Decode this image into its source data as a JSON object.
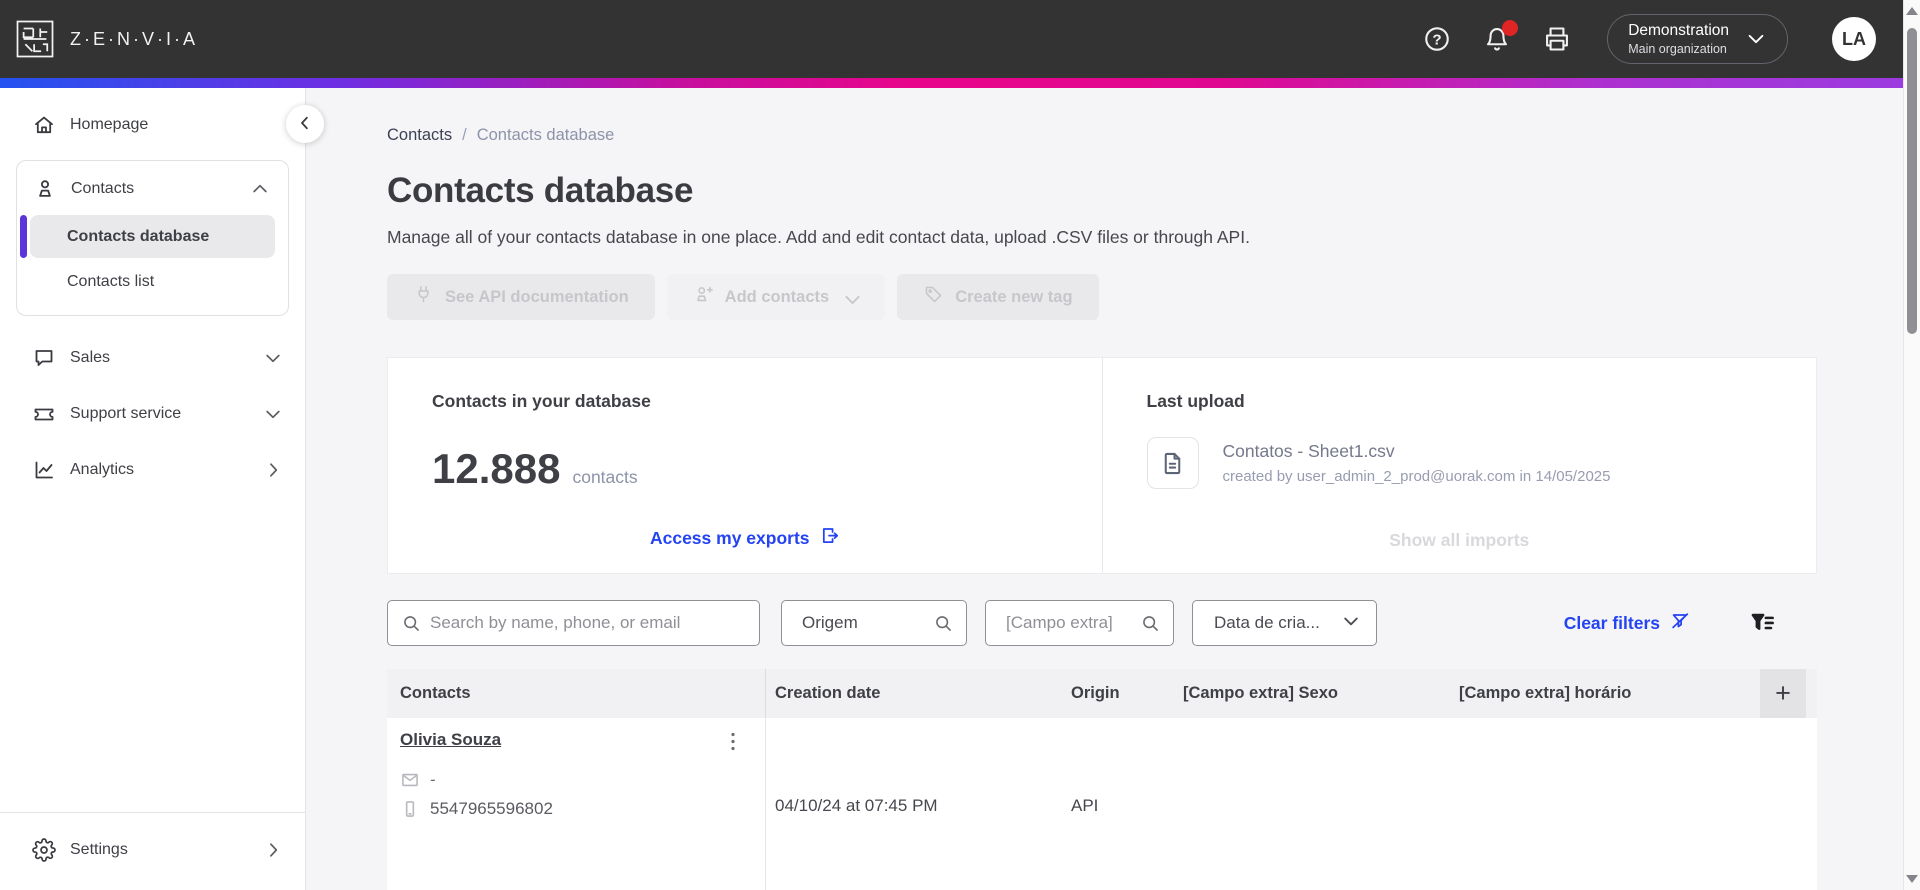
{
  "topbar": {
    "brand": "Z·E·N·V·I·A",
    "org_name": "Demonstration",
    "org_sub": "Main organization",
    "avatar_initials": "LA"
  },
  "sidebar": {
    "homepage": "Homepage",
    "contacts": "Contacts",
    "contacts_database": "Contacts database",
    "contacts_list": "Contacts list",
    "sales": "Sales",
    "support": "Support service",
    "analytics": "Analytics",
    "settings": "Settings"
  },
  "breadcrumb": {
    "parent": "Contacts",
    "separator": "/",
    "current": "Contacts database"
  },
  "page": {
    "title": "Contacts database",
    "description": "Manage all of your contacts database in one place. Add and edit contact data, upload .CSV files or through API."
  },
  "actions": {
    "see_api": "See API documentation",
    "add_contacts": "Add contacts",
    "create_tag": "Create new tag"
  },
  "stats_card": {
    "title": "Contacts in your database",
    "count": "12.888",
    "unit": "contacts",
    "link": "Access my exports"
  },
  "upload_card": {
    "title": "Last upload",
    "filename": "Contatos - Sheet1.csv",
    "meta": "created by user_admin_2_prod@uorak.com in 14/05/2025",
    "link": "Show all imports"
  },
  "filters": {
    "search_placeholder": "Search by name, phone, or email",
    "origem": "Origem",
    "campo_extra": "[Campo extra]",
    "creation_date": "Data de cria...",
    "clear": "Clear filters"
  },
  "table": {
    "columns": {
      "contacts": "Contacts",
      "creation_date": "Creation date",
      "origin": "Origin",
      "sexo": "[Campo extra] Sexo",
      "horario": "[Campo extra] horário"
    },
    "add_column": "+",
    "rows": [
      {
        "name": "Olivia Souza",
        "email": "-",
        "phone": "5547965596802",
        "creation_date": "04/10/24 at 07:45 PM",
        "origin": "API"
      }
    ]
  },
  "colors": {
    "topbar_bg": "#333333",
    "gradient_start": "#2453F0",
    "gradient_mid": "#E8058B",
    "gradient_end": "#9B3BE0",
    "accent_blue": "#2443F2",
    "active_purple": "#5B35D9",
    "notification_red": "#E02525"
  }
}
